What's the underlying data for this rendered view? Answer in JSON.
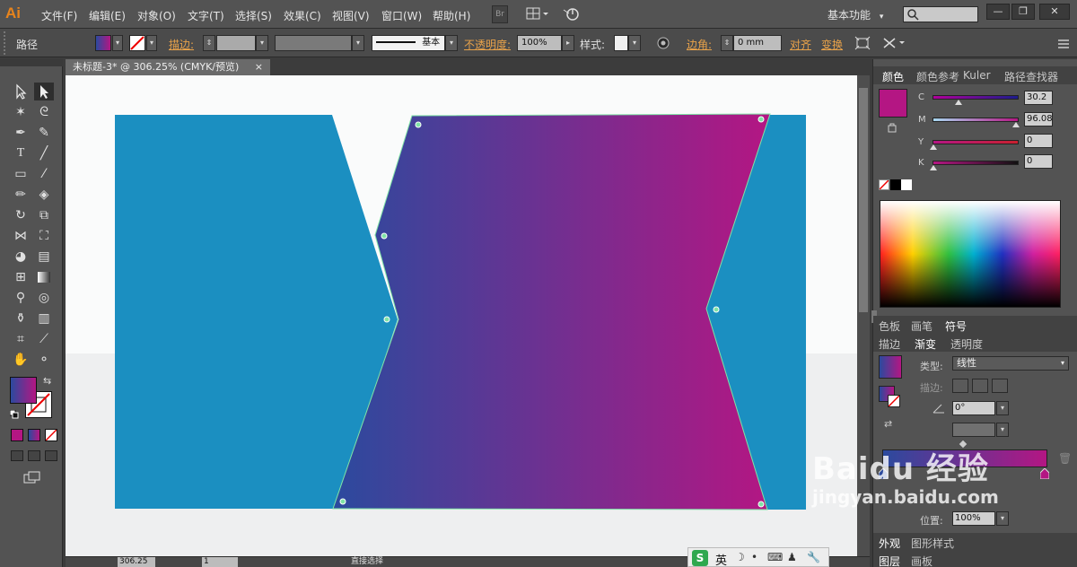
{
  "app": {
    "logo": "Ai"
  },
  "menu": [
    "文件(F)",
    "编辑(E)",
    "对象(O)",
    "文字(T)",
    "选择(S)",
    "效果(C)",
    "视图(V)",
    "窗口(W)",
    "帮助(H)"
  ],
  "menubar": {
    "br_label": "Br",
    "workspace": "基本功能",
    "workspace_arrow": "▾"
  },
  "window_controls": [
    "—",
    "❐",
    "✕"
  ],
  "control": {
    "object_type": "路径",
    "stroke_label": "描边:",
    "stroke_style": "基本",
    "opacity_label": "不透明度:",
    "opacity_value": "100%",
    "style_label": "样式:",
    "corner_label": "边角:",
    "corner_value": "0 mm",
    "align_label": "对齐",
    "transform_label": "变换"
  },
  "document": {
    "tab_title": "未标题-3* @ 306.25% (CMYK/预览)",
    "close": "×",
    "zoom": "306.25",
    "page": "1",
    "status_tool": "直接选择"
  },
  "colors": {
    "cyan_shape": "#1b8fc1",
    "gradient_start": "#2b4a9e",
    "gradient_end": "#b41683",
    "accent": "#e8a24a"
  },
  "color_panel": {
    "tabs": [
      "颜色",
      "颜色参考",
      "Kuler",
      "路径查找器"
    ],
    "channels": [
      {
        "label": "C",
        "value": "30.2"
      },
      {
        "label": "M",
        "value": "96.08"
      },
      {
        "label": "Y",
        "value": "0"
      },
      {
        "label": "K",
        "value": "0"
      }
    ]
  },
  "swatch_panel": {
    "tabs": [
      "色板",
      "画笔",
      "符号"
    ]
  },
  "gradient_panel": {
    "tabs": [
      "描边",
      "渐变",
      "透明度"
    ],
    "type_label": "类型:",
    "type_value": "线性",
    "stroke_label": "描边:",
    "angle_value": "0°",
    "position_label": "位置:",
    "position_value": "100%"
  },
  "bottom_tabs": [
    "外观",
    "图形样式"
  ],
  "layer_tabs": [
    "图层",
    "画板"
  ],
  "ime": {
    "lang": "英"
  },
  "watermark": {
    "line1": "Baidu 经验",
    "line2": "jingyan.baidu.com"
  }
}
